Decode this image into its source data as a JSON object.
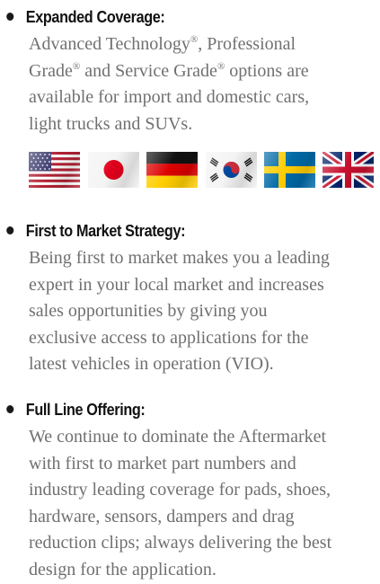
{
  "sections": [
    {
      "title": "Expanded Coverage:",
      "body_lines": [
        [
          "Advanced Technology",
          "®",
          ", Professional"
        ],
        [
          "Grade",
          "®",
          " and Service Grade",
          "®",
          " options are"
        ],
        [
          "available for import and domestic cars,"
        ],
        [
          "light trucks and SUVs."
        ]
      ]
    },
    {
      "title": "First to Market Strategy:",
      "body_lines": [
        "Being first to market makes you a leading",
        "expert in your local market and increases",
        "sales opportunities by giving you",
        "exclusive access to applications for the",
        "latest vehicles in operation (VIO)."
      ]
    },
    {
      "title": "Full Line Offering:",
      "body_lines": [
        "We continue to dominate the Aftermarket",
        "with first to market part numbers and",
        "industry leading coverage for pads, shoes,",
        "hardware, sensors, dampers and drag",
        "reduction clips; always delivering the best",
        "design for the application."
      ]
    }
  ],
  "flags": [
    {
      "name": "usa-flag-icon",
      "country": "United States"
    },
    {
      "name": "japan-flag-icon",
      "country": "Japan"
    },
    {
      "name": "germany-flag-icon",
      "country": "Germany"
    },
    {
      "name": "south-korea-flag-icon",
      "country": "South Korea"
    },
    {
      "name": "sweden-flag-icon",
      "country": "Sweden"
    },
    {
      "name": "united-kingdom-flag-icon",
      "country": "United Kingdom"
    }
  ],
  "colors": {
    "heading": "#111111",
    "body": "#707070",
    "bullet": "#1a1a1a"
  }
}
